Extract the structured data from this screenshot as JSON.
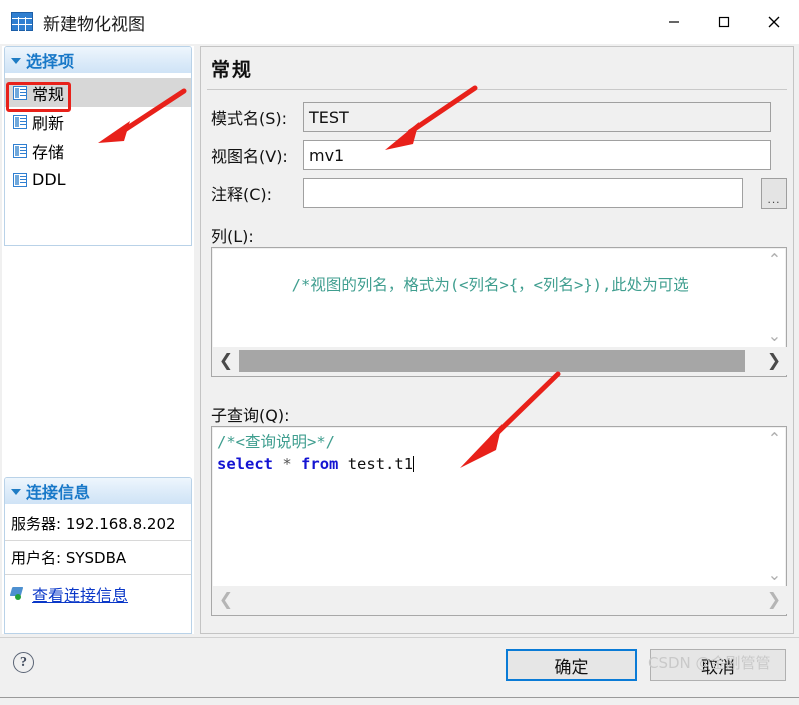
{
  "window": {
    "title": "新建物化视图",
    "icon": "table-grid-icon",
    "controls": {
      "minimize": "minimize-icon",
      "maximize": "maximize-icon",
      "close": "close-icon"
    }
  },
  "sidebar": {
    "options_panel": {
      "header": "选择项",
      "items": [
        {
          "label": "常规",
          "selected": true
        },
        {
          "label": "刷新",
          "selected": false
        },
        {
          "label": "存储",
          "selected": false
        },
        {
          "label": "DDL",
          "selected": false
        }
      ]
    },
    "connection_panel": {
      "header": "连接信息",
      "server_row": "服务器: 192.168.8.202",
      "user_row": "用户名: SYSDBA",
      "link": "查看连接信息"
    }
  },
  "main": {
    "title": "常规",
    "fields": {
      "schema": {
        "label": "模式名(S):",
        "value": "TEST",
        "readonly": true
      },
      "view_name": {
        "label": "视图名(V):",
        "value": "mv1",
        "readonly": false
      },
      "comment": {
        "label": "注释(C):",
        "value": "",
        "readonly": false
      },
      "browse_button": "..."
    },
    "columns_section": {
      "label": "列(L):",
      "text": "/*视图的列名，格式为(<列名>{，<列名>}),此处为可选",
      "scroll_up": "⌃",
      "scroll_down": "⌄",
      "scroll_left": "❮",
      "scroll_right": "❯"
    },
    "subquery_section": {
      "label": "子查询(Q):",
      "comment_line": "/*<查询说明>*/",
      "sql_keyword_1": "select",
      "sql_star": "*",
      "sql_keyword_2": "from",
      "sql_table": "test.t1",
      "scroll_up": "⌃",
      "scroll_down": "⌄",
      "scroll_left": "❮",
      "scroll_right": "❯"
    }
  },
  "footer": {
    "help": "?",
    "ok_button": "确定",
    "cancel_button": "取消",
    "watermark": "CSDN @金刚管管"
  },
  "colors": {
    "accent": "#1878c8",
    "annotation": "#e8211a",
    "keyword": "#1414d2",
    "comment": "#3f9e8f",
    "link": "#0b38c8"
  }
}
